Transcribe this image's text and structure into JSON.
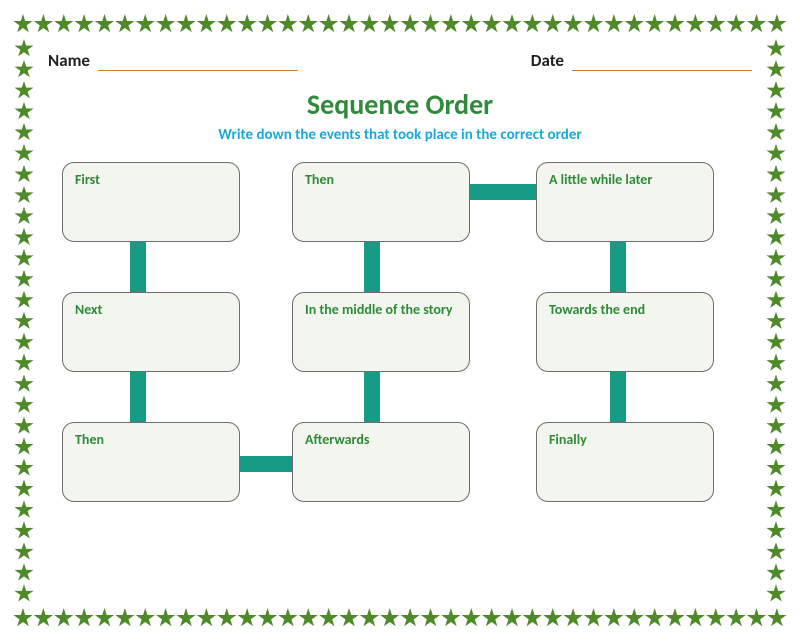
{
  "meta": {
    "name_label": "Name",
    "date_label": "Date"
  },
  "title": "Sequence Order",
  "subtitle": "Write down the events that took place in the correct order",
  "boxes": {
    "b1": "First",
    "b2": "Then",
    "b3": "A little while later",
    "b4": "Next",
    "b5": "In the middle of the story",
    "b6": "Towards the end",
    "b7": "Then",
    "b8": "Afterwards",
    "b9": "Finally"
  }
}
